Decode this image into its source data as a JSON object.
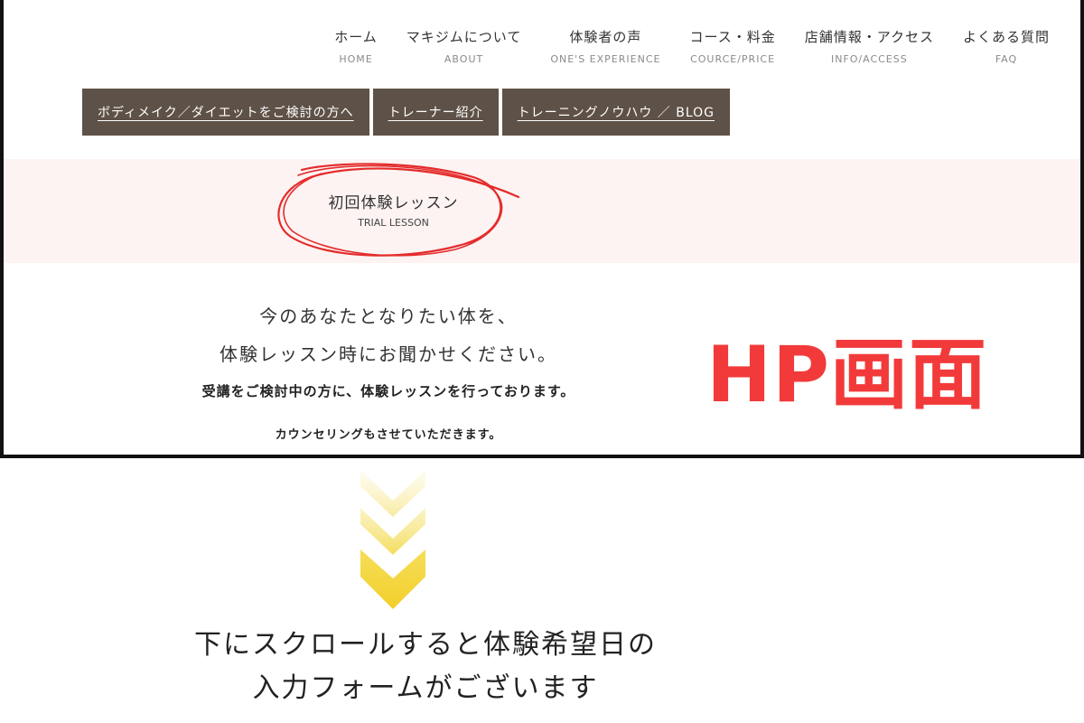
{
  "nav": [
    {
      "jp": "ホーム",
      "en": "HOME"
    },
    {
      "jp": "マキジムについて",
      "en": "ABOUT"
    },
    {
      "jp": "体験者の声",
      "en": "ONE'S EXPERIENCE"
    },
    {
      "jp": "コース・料金",
      "en": "COURCE/PRICE"
    },
    {
      "jp": "店舗情報・アクセス",
      "en": "INFO/ACCESS"
    },
    {
      "jp": "よくある質問",
      "en": "FAQ"
    }
  ],
  "subnav": [
    {
      "label": "ボディメイク／ダイエットをご検討の方へ"
    },
    {
      "label": "トレーナー紹介"
    },
    {
      "label": "トレーニングノウハウ ／ BLOG"
    }
  ],
  "trial": {
    "jp": "初回体験レッスン",
    "en": "TRIAL LESSON"
  },
  "lead": {
    "line1": "今のあなたとなりたい体を、",
    "line2": "体験レッスン時にお聞かせください。",
    "line3": "受講をご検討中の方に、体験レッスンを行っております。",
    "line4": "カウンセリングもさせていただきます。"
  },
  "annotation": {
    "hp_label": "HP画面",
    "hp_color": "#f23a3a"
  },
  "caption": {
    "line1": "下にスクロールすると体験希望日の",
    "line2": "入力フォームがございます"
  },
  "colors": {
    "subnav_bg": "#5e5147",
    "band_bg": "#fcf3f2",
    "arrow": "#f5d635"
  }
}
